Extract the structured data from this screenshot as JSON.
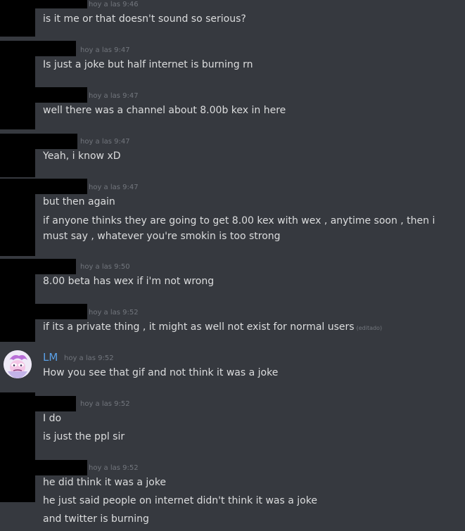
{
  "messages": [
    {
      "time": "hoy a las 9:46",
      "lines": [
        "is it me or that doesn't sound so serious?"
      ]
    },
    {
      "time": "hoy a las 9:47",
      "lines": [
        "Is just a joke but half internet is burning rn"
      ]
    },
    {
      "time": "hoy a las 9:47",
      "lines": [
        "well there was a channel about 8.00b kex in here"
      ]
    },
    {
      "time": "hoy a las 9:47",
      "lines": [
        "Yeah, i know xD"
      ]
    },
    {
      "time": "hoy a las 9:47",
      "lines": [
        "but then again",
        "if anyone thinks they are going to get 8.00 kex with wex , anytime soon , then i must say , whatever you're smokin is too strong"
      ]
    },
    {
      "time": "hoy a las 9:50",
      "lines": [
        "8.00 beta has wex if i'm not wrong"
      ]
    },
    {
      "time": "hoy a las 9:52",
      "lines": [
        "if its a private thing , it might as well not exist for normal users"
      ],
      "edited": "(editado)"
    },
    {
      "author": "LM",
      "time": "hoy a las 9:52",
      "lines": [
        "How you see that gif and not think it was a joke"
      ]
    },
    {
      "time": "hoy a las 9:52",
      "lines": [
        "I do",
        "is just the ppl sir"
      ]
    },
    {
      "time": "hoy a las 9:52",
      "lines": [
        "he did think it was a joke",
        "he just said people on internet didn't think it was a joke",
        "and twitter is burning"
      ]
    }
  ],
  "colors": {
    "background": "#36393f",
    "text": "#dcddde",
    "timestamp": "#72767d",
    "author_lm": "#5aa0e6",
    "redaction": "#000000"
  }
}
